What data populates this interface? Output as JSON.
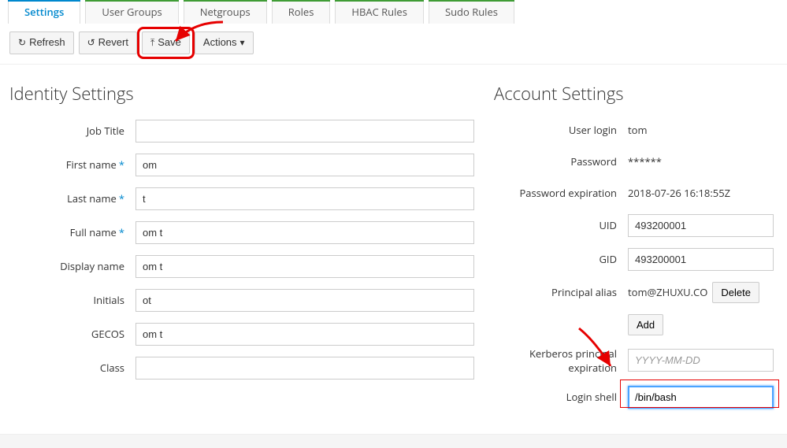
{
  "tabs": {
    "settings": "Settings",
    "user_groups": "User Groups",
    "netgroups": "Netgroups",
    "roles": "Roles",
    "hbac_rules": "HBAC Rules",
    "sudo_rules": "Sudo Rules"
  },
  "toolbar": {
    "refresh": "Refresh",
    "revert": "Revert",
    "save": "Save",
    "actions": "Actions"
  },
  "identity": {
    "heading": "Identity Settings",
    "labels": {
      "job_title": "Job Title",
      "first_name": "First name",
      "last_name": "Last name",
      "full_name": "Full name",
      "display_name": "Display name",
      "initials": "Initials",
      "gecos": "GECOS",
      "class": "Class"
    },
    "values": {
      "job_title": "",
      "first_name": "om",
      "last_name": "t",
      "full_name": "om t",
      "display_name": "om t",
      "initials": "ot",
      "gecos": "om t",
      "class": ""
    }
  },
  "account": {
    "heading": "Account Settings",
    "labels": {
      "user_login": "User login",
      "password": "Password",
      "password_expiration": "Password expiration",
      "uid": "UID",
      "gid": "GID",
      "principal_alias": "Principal alias",
      "kerberos_expiration": "Kerberos principal expiration",
      "login_shell": "Login shell"
    },
    "values": {
      "user_login": "tom",
      "password": "******",
      "password_expiration": "2018-07-26 16:18:55Z",
      "uid": "493200001",
      "gid": "493200001",
      "principal_alias": "tom@ZHUXU.CO",
      "kerberos_expiration_placeholder": "YYYY-MM-DD",
      "login_shell": "/bin/bash"
    },
    "buttons": {
      "delete": "Delete",
      "add": "Add"
    }
  }
}
